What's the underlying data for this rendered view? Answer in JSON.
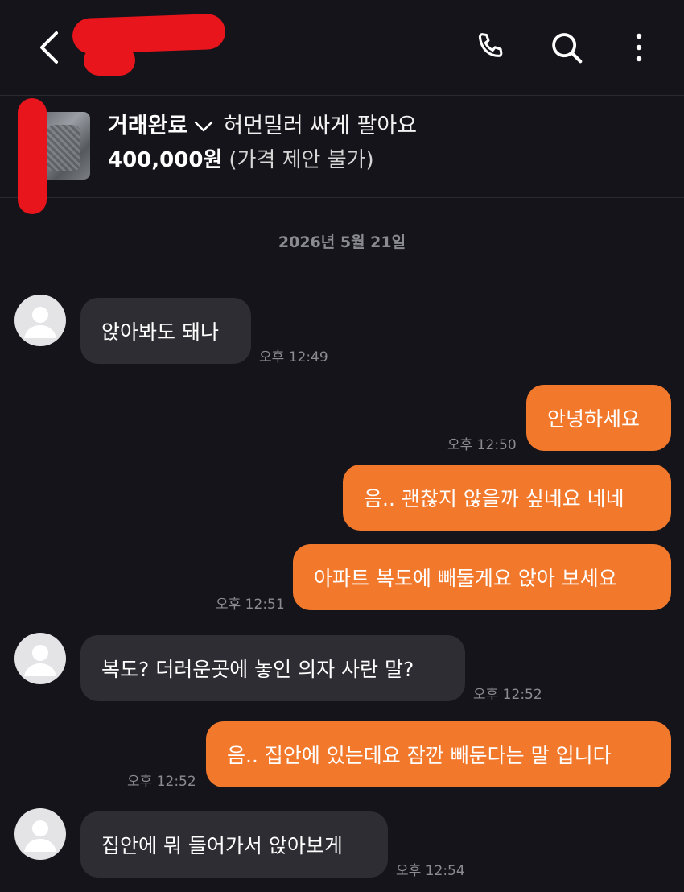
{
  "header": {
    "back_icon": "chevron-left-icon",
    "call_icon": "phone-icon",
    "search_icon": "search-icon",
    "menu_icon": "more-vertical-icon"
  },
  "product": {
    "status": "거래완료",
    "title": "허먼밀러 싸게 팔아요",
    "price": "400,000원",
    "price_note": "(가격 제안 불가)"
  },
  "chat": {
    "date": "2026년 5월 21일",
    "messages": [
      {
        "side": "in",
        "text": "앉아봐도 돼나",
        "time": "오후 12:49"
      },
      {
        "side": "out",
        "text": "안녕하세요",
        "time": "오후 12:50"
      },
      {
        "side": "out",
        "text": "음.. 괜찮지 않을까 싶네요 네네",
        "time": ""
      },
      {
        "side": "out",
        "text": "아파트 복도에 빼둘게요 앉아 보세요",
        "time": "오후 12:51"
      },
      {
        "side": "in",
        "text": "복도? 더러운곳에 놓인 의자 사란 말?",
        "time": "오후 12:52"
      },
      {
        "side": "out",
        "text": "음.. 집안에 있는데요 잠깐 빼둔다는 말 입니다",
        "time": "오후 12:52"
      },
      {
        "side": "in",
        "text": "집안에 뭐 들어가서 앉아보게",
        "time": "오후 12:54"
      }
    ]
  },
  "colors": {
    "background": "#15141a",
    "incoming_bubble": "#2e2d33",
    "outgoing_bubble": "#f2782c",
    "redaction": "#e8151c"
  }
}
